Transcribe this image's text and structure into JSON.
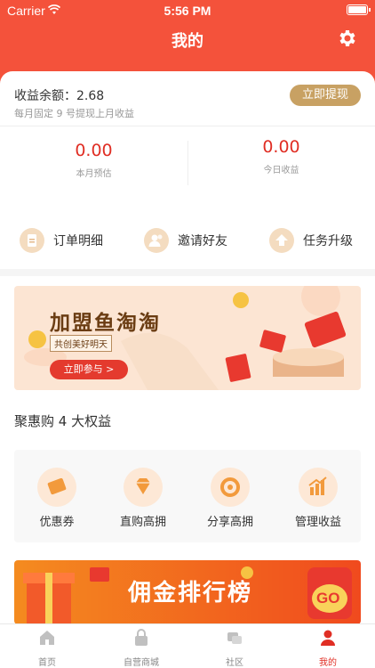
{
  "status": {
    "carrier": "Carrier",
    "time": "5:56 PM"
  },
  "header": {
    "title": "我的"
  },
  "balance": {
    "label": "收益余额：",
    "value": "2.68",
    "note": "每月固定 9 号提现上月收益",
    "withdraw_label": "立即提现"
  },
  "stats": [
    {
      "value": "0.00",
      "label": "本月预估"
    },
    {
      "value": "0.00",
      "label": "今日收益"
    }
  ],
  "quick": [
    {
      "label": "订单明细",
      "icon": "document-icon"
    },
    {
      "label": "邀请好友",
      "icon": "users-icon"
    },
    {
      "label": "任务升级",
      "icon": "upgrade-arrow-icon"
    }
  ],
  "banner": {
    "title": "加盟鱼淘淘",
    "subtitle": "共创美好明天",
    "button": "立即参与 >"
  },
  "rights_title": "聚惠购 4 大权益",
  "rights": [
    {
      "label": "优惠券",
      "icon": "coupon-icon"
    },
    {
      "label": "直购高拥",
      "icon": "diamond-icon"
    },
    {
      "label": "分享高拥",
      "icon": "share-shutter-icon"
    },
    {
      "label": "管理收益",
      "icon": "bar-chart-icon"
    }
  ],
  "bottom_banner": {
    "title": "佣金排行榜",
    "go": "GO"
  },
  "tabs": [
    {
      "label": "首页",
      "icon": "home-icon"
    },
    {
      "label": "自营商城",
      "icon": "shop-lock-icon"
    },
    {
      "label": "社区",
      "icon": "community-icon"
    },
    {
      "label": "我的",
      "icon": "profile-icon"
    }
  ],
  "colors": {
    "primary": "#f4523b",
    "accent": "#e02e24",
    "gold": "#c8a163"
  }
}
